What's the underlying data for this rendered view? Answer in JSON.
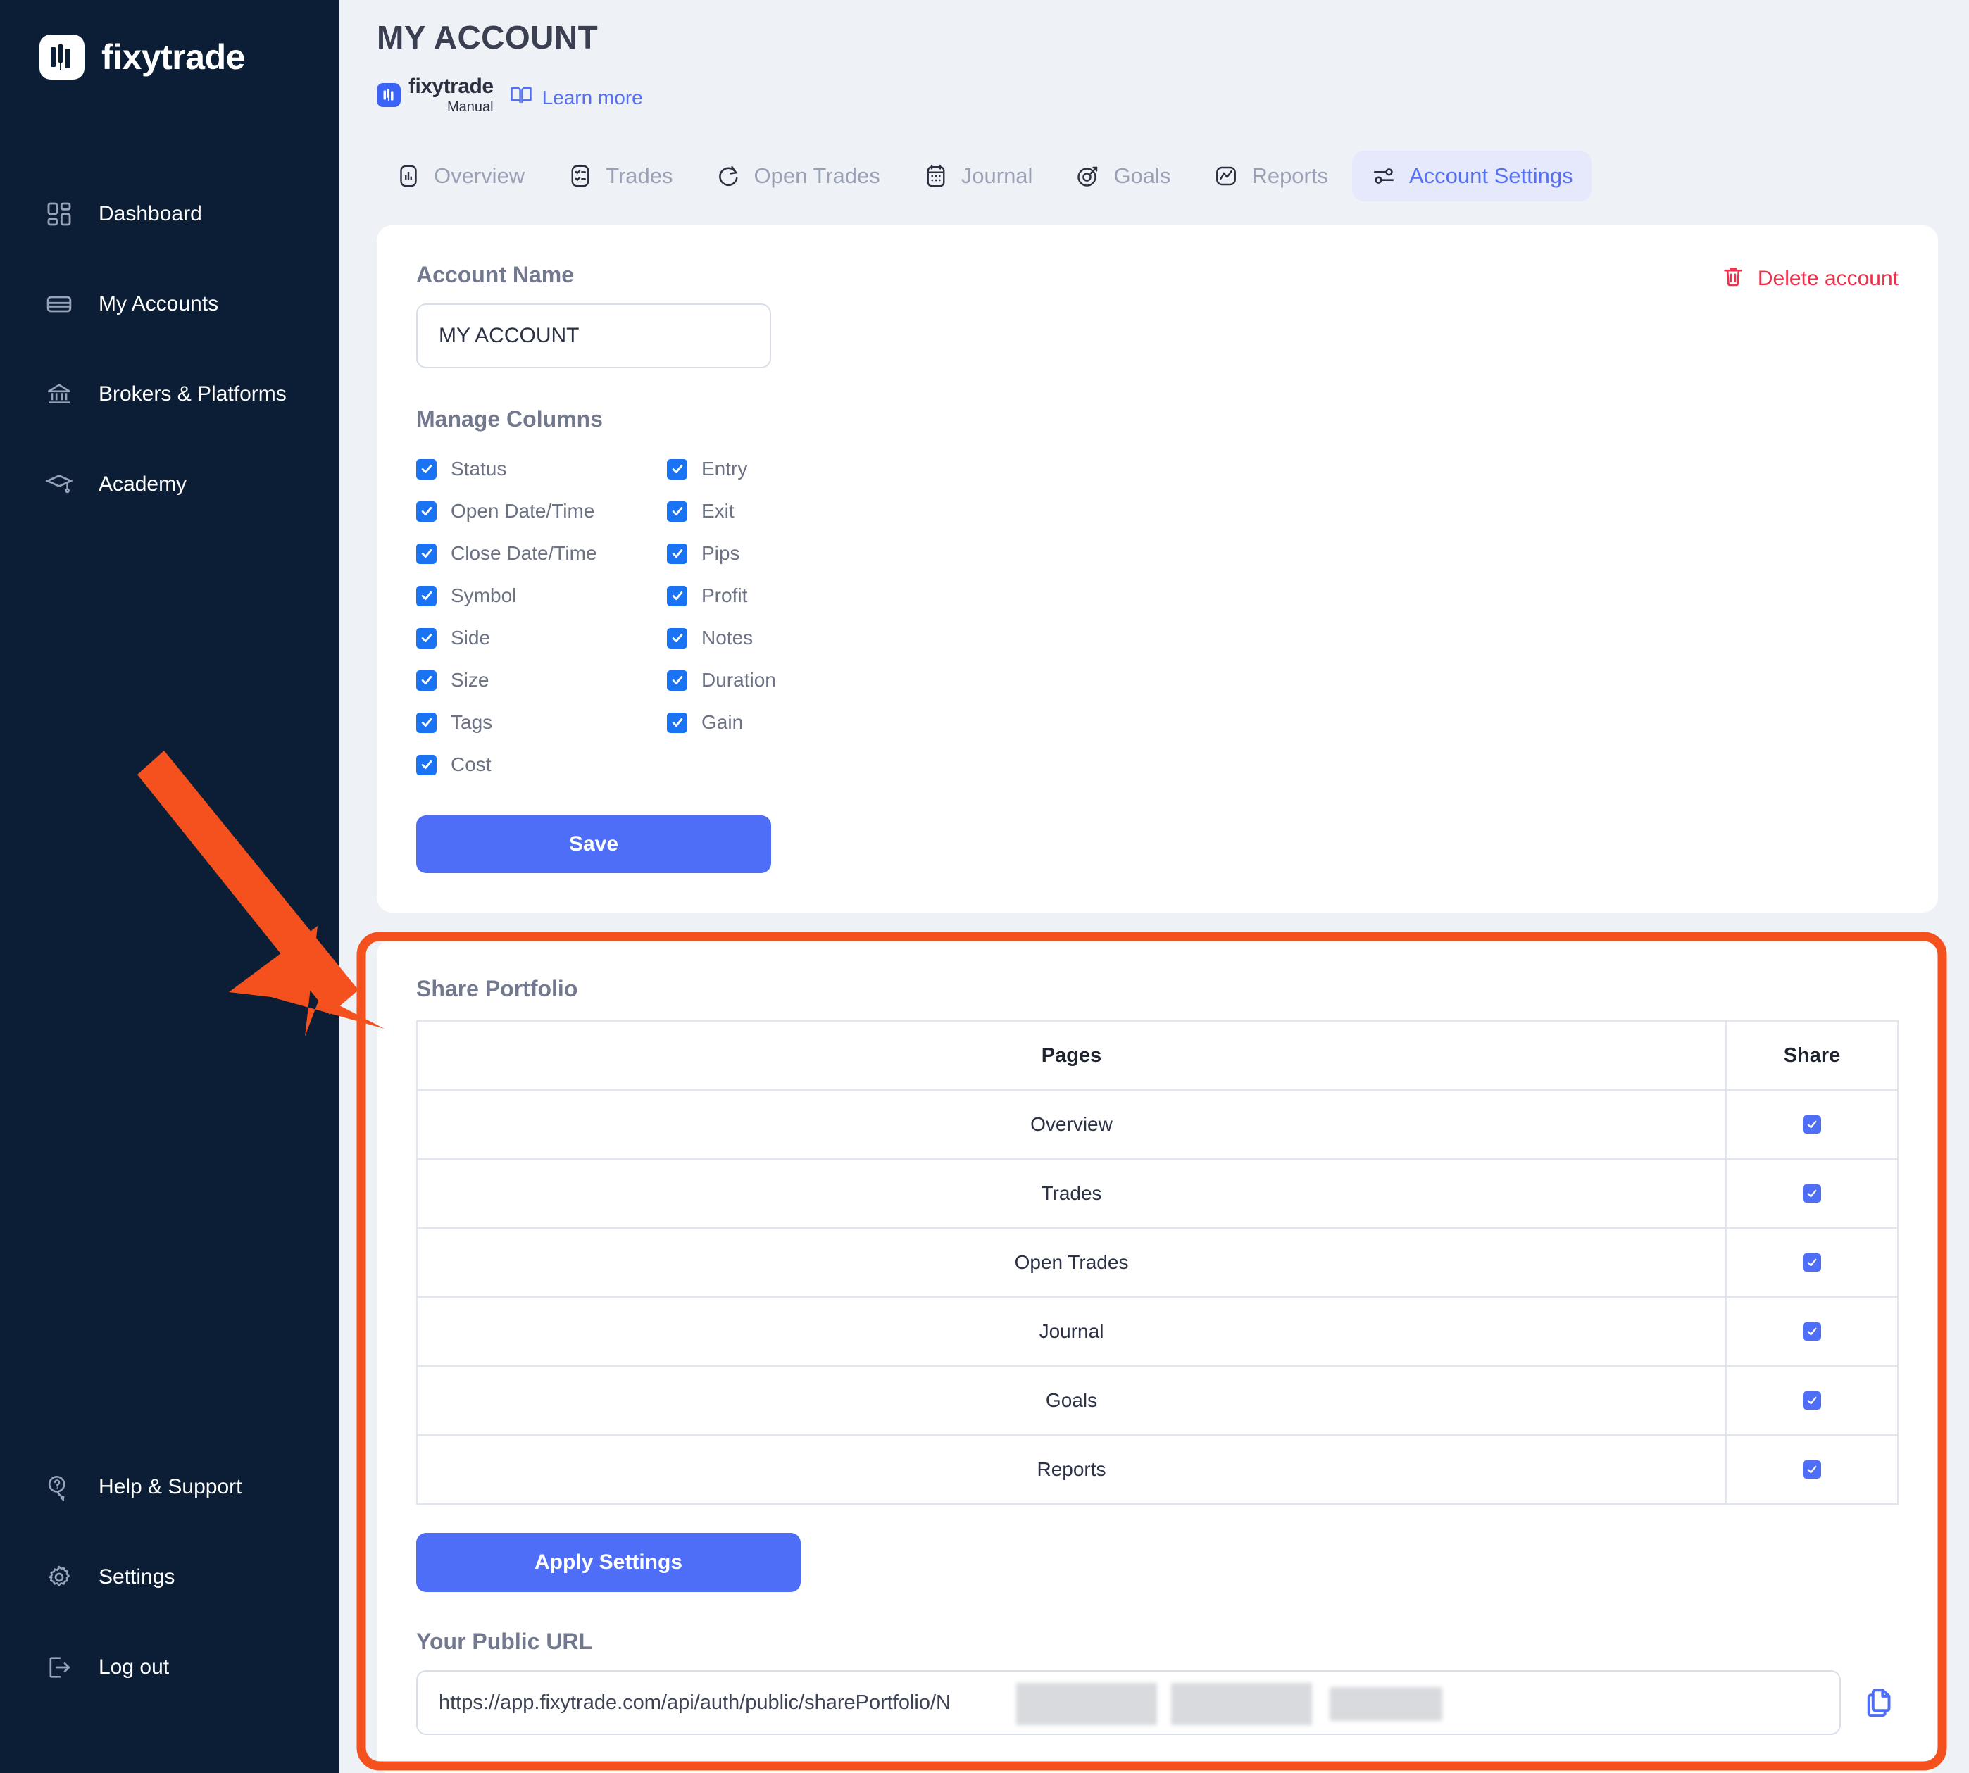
{
  "brand": {
    "name": "fixytrade",
    "logo_icon": "fixytrade-logo-icon"
  },
  "sidebar": {
    "top_items": [
      {
        "label": "Dashboard",
        "icon": "dashboard-grid-icon"
      },
      {
        "label": "My Accounts",
        "icon": "credit-card-icon"
      },
      {
        "label": "Brokers & Platforms",
        "icon": "bank-icon"
      },
      {
        "label": "Academy",
        "icon": "graduation-cap-icon"
      }
    ],
    "bottom_items": [
      {
        "label": "Help & Support",
        "icon": "help-chat-icon"
      },
      {
        "label": "Settings",
        "icon": "gear-icon"
      },
      {
        "label": "Log out",
        "icon": "logout-icon"
      }
    ]
  },
  "header": {
    "title": "MY ACCOUNT",
    "manual_brand": "fixytrade",
    "manual_sub": "Manual",
    "learn_more": "Learn more",
    "learn_more_icon": "book-open-icon"
  },
  "tabs": [
    {
      "label": "Overview",
      "icon": "bar-chart-icon",
      "active": false
    },
    {
      "label": "Trades",
      "icon": "checklist-icon",
      "active": false
    },
    {
      "label": "Open Trades",
      "icon": "refresh-icon",
      "active": false
    },
    {
      "label": "Journal",
      "icon": "calendar-icon",
      "active": false
    },
    {
      "label": "Goals",
      "icon": "target-icon",
      "active": false
    },
    {
      "label": "Reports",
      "icon": "chart-line-icon",
      "active": false
    },
    {
      "label": "Account Settings",
      "icon": "sliders-icon",
      "active": true
    }
  ],
  "account_card": {
    "account_name_label": "Account Name",
    "account_name_value": "MY ACCOUNT",
    "account_name_placeholder": "Account Name",
    "delete_account_label": "Delete account",
    "delete_icon": "trash-icon",
    "manage_columns_label": "Manage Columns",
    "columns_left": [
      {
        "label": "Status",
        "checked": true
      },
      {
        "label": "Open Date/Time",
        "checked": true
      },
      {
        "label": "Close Date/Time",
        "checked": true
      },
      {
        "label": "Symbol",
        "checked": true
      },
      {
        "label": "Side",
        "checked": true
      },
      {
        "label": "Size",
        "checked": true
      },
      {
        "label": "Tags",
        "checked": true
      },
      {
        "label": "Cost",
        "checked": true
      }
    ],
    "columns_right": [
      {
        "label": "Entry",
        "checked": true
      },
      {
        "label": "Exit",
        "checked": true
      },
      {
        "label": "Pips",
        "checked": true
      },
      {
        "label": "Profit",
        "checked": true
      },
      {
        "label": "Notes",
        "checked": true
      },
      {
        "label": "Duration",
        "checked": true
      },
      {
        "label": "Gain",
        "checked": true
      }
    ],
    "save_label": "Save"
  },
  "share_card": {
    "title": "Share Portfolio",
    "table": {
      "headers": [
        "Pages",
        "Share"
      ],
      "rows": [
        {
          "page": "Overview",
          "share": true
        },
        {
          "page": "Trades",
          "share": true
        },
        {
          "page": "Open Trades",
          "share": true
        },
        {
          "page": "Journal",
          "share": true
        },
        {
          "page": "Goals",
          "share": true
        },
        {
          "page": "Reports",
          "share": true
        }
      ]
    },
    "apply_label": "Apply Settings",
    "url_label": "Your Public URL",
    "url_value": "https://app.fixytrade.com/api/auth/public/sharePortfolio/N",
    "copy_icon": "copy-icon"
  },
  "annotation": {
    "arrow_color": "#f4511e",
    "highlight_color": "#f4511e"
  },
  "colors": {
    "sidebar_bg": "#0b1e35",
    "page_bg": "#eef2f7",
    "accent_blue": "#4f6ef7",
    "tab_active_bg": "#e5e9fb",
    "checkbox_blue": "#1a73f2",
    "danger_red": "#f0304a",
    "annotation_orange": "#f4511e"
  }
}
